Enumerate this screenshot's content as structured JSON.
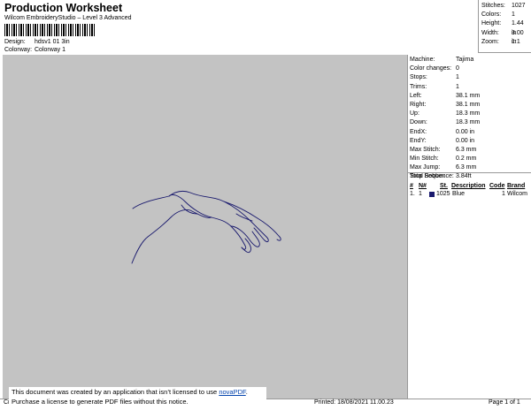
{
  "header": {
    "title": "Production Worksheet",
    "subtitle": "Wilcom EmbroideryStudio – Level 3 Advanced"
  },
  "design": {
    "design_label": "Design:",
    "design_value": "hdsv1 01 3in",
    "colorway_label": "Colorway:",
    "colorway_value": "Colorway 1"
  },
  "summary": [
    {
      "label": "Stitches:",
      "value": "1027"
    },
    {
      "label": "Colors:",
      "value": "1"
    },
    {
      "label": "Height:",
      "value": "1.44 in"
    },
    {
      "label": "Width:",
      "value": "3.00 in"
    },
    {
      "label": "Zoom:",
      "value": "1:1"
    }
  ],
  "machine": [
    {
      "label": "Machine:",
      "value": "Tajima"
    },
    {
      "label": "Color changes:",
      "value": "0"
    },
    {
      "label": "Stops:",
      "value": "1"
    },
    {
      "label": "Trims:",
      "value": "1"
    },
    {
      "label": "Left:",
      "value": "38.1 mm"
    },
    {
      "label": "Right:",
      "value": "38.1 mm"
    },
    {
      "label": "Up:",
      "value": "18.3 mm"
    },
    {
      "label": "Down:",
      "value": "18.3 mm"
    },
    {
      "label": "EndX:",
      "value": "0.00 in"
    },
    {
      "label": "EndY:",
      "value": "0.00 in"
    },
    {
      "label": "Max Stitch:",
      "value": "6.3 mm"
    },
    {
      "label": "Min Stitch:",
      "value": "0.2 mm"
    },
    {
      "label": "Max Jump:",
      "value": "6.3 mm"
    },
    {
      "label": "Total Bobbin:",
      "value": "3.84ft"
    }
  ],
  "stops": {
    "title": "Stop Sequence:",
    "headers": [
      "#",
      "N#",
      "St.",
      "Description",
      "Code",
      "Brand"
    ],
    "rows": [
      {
        "num": "1.",
        "n": "1",
        "st": "1025",
        "desc": "Blue",
        "code": "1",
        "brand": "Wilcom",
        "color": "#1a1a6e"
      }
    ]
  },
  "notice": {
    "line1_pre": "This document was created by an application that isn’t licensed to use ",
    "link": "novaPDF",
    "line1_post": ".",
    "line2": "Purchase a license to generate PDF files without this notice."
  },
  "footer": {
    "left": "Cr",
    "printed": "Printed: 18/08/2021 11.00.23",
    "page": "Page 1 of 1"
  },
  "colors": {
    "canvas": "#c3c3c3",
    "thread": "#1a1a6e"
  }
}
